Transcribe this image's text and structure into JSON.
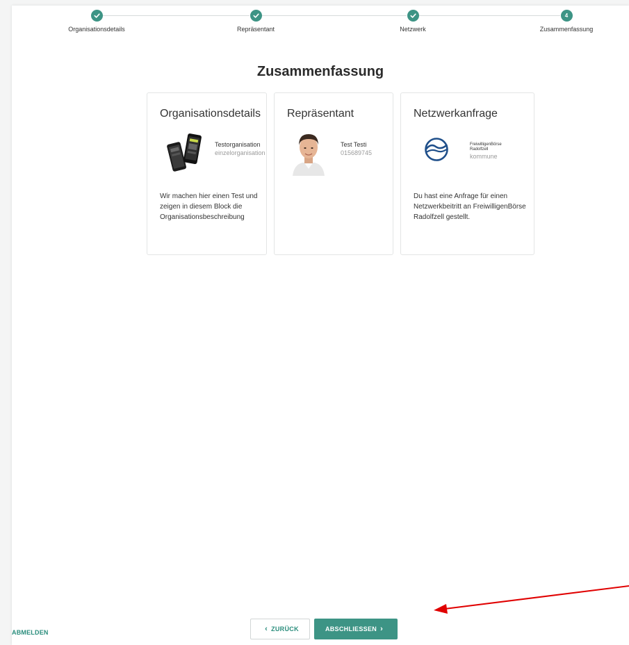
{
  "stepper": {
    "steps": [
      {
        "label": "Organisationsdetails",
        "state": "done"
      },
      {
        "label": "Repräsentant",
        "state": "done"
      },
      {
        "label": "Netzwerk",
        "state": "done"
      },
      {
        "label": "Zusammenfassung",
        "state": "current",
        "number": "4"
      }
    ]
  },
  "summary": {
    "title": "Zusammenfassung"
  },
  "cards": {
    "organisation": {
      "title": "Organisationsdetails",
      "name": "Testorganisation",
      "type": "einzelorganisation",
      "description": "Wir machen hier einen Test und zeigen in diesem Block die Organisationsbeschreibung",
      "image_icon": "phones-image"
    },
    "representative": {
      "title": "Repräsentant",
      "name": "Test Testi",
      "phone": "015689745",
      "image_icon": "portrait-avatar"
    },
    "network": {
      "title": "Netzwerkanfrage",
      "org_name_line1": "FreiwilligenBörse",
      "org_name_line2": "Radolfzell",
      "org_type": "kommune",
      "description": "Du hast eine Anfrage für einen Netzwerkbeitritt an FreiwilligenBörse Radolfzell gestellt.",
      "logo_icon": "wave-circle-logo"
    }
  },
  "footer": {
    "logout_label": "ABMELDEN",
    "back_label": "ZURÜCK",
    "finish_label": "ABSCHLIESSEN"
  },
  "colors": {
    "accent": "#3d9485",
    "link": "#2a8d7c",
    "annotation_arrow": "#e00000",
    "logo_blue": "#1f4f8a"
  }
}
